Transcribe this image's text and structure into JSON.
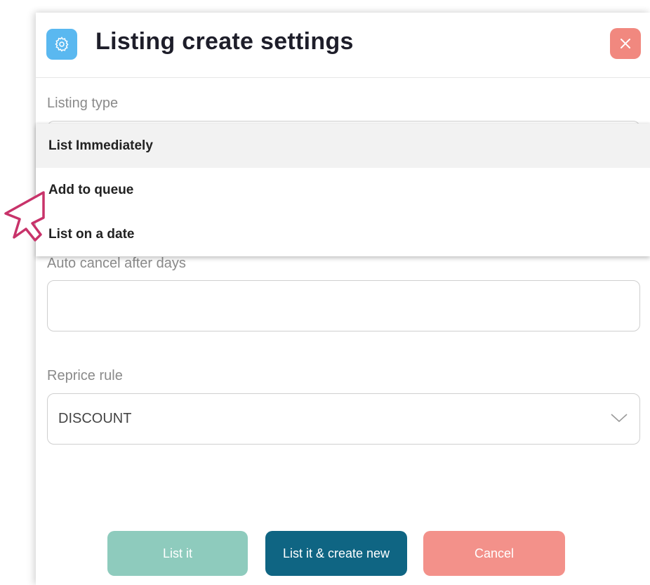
{
  "modal": {
    "title": "Listing create settings",
    "icon": "gear-icon",
    "close_icon": "close-icon",
    "accent_color": "#5ab8f0",
    "close_color": "#f1887f"
  },
  "listing_type": {
    "label": "Listing type",
    "options": [
      "List Immediately",
      "Add to queue",
      "List on a date"
    ],
    "highlighted": "List Immediately"
  },
  "auto_cancel": {
    "label": "Auto cancel after days",
    "value": ""
  },
  "reprice_rule": {
    "label": "Reprice rule",
    "value": "DISCOUNT"
  },
  "buttons": {
    "list_it": "List it",
    "list_create_new": "List it & create new",
    "cancel": "Cancel"
  },
  "colors": {
    "list_it": "#8ecbbd",
    "list_create_new": "#0f6583",
    "cancel": "#f3918a",
    "cursor": "#c8336a"
  }
}
